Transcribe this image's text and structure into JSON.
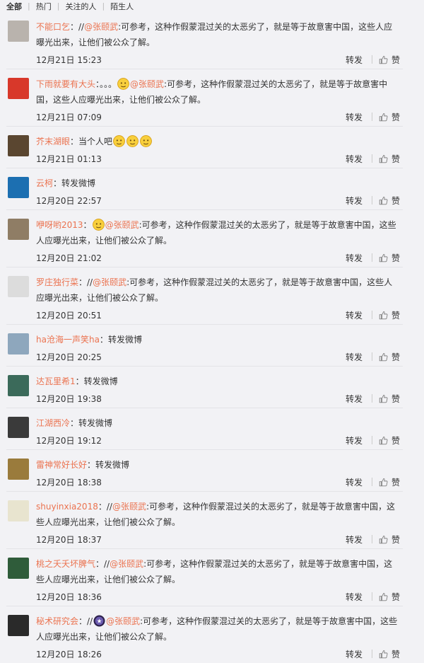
{
  "tabs": [
    "全部",
    "热门",
    "关注的人",
    "陌生人"
  ],
  "actions": {
    "forward": "转发",
    "like": "赞"
  },
  "comments": [
    {
      "user": "不能口乞",
      "sep": "：//",
      "mention": "@张颐武",
      "text": ":可参考，这种作假蒙混过关的太恶劣了，就是等于故意害中国，这些人应曝光出来，让他们被公众了解。",
      "time": "12月21日 15:23",
      "avatar_color": "#b9b3ad",
      "emoji": ""
    },
    {
      "user": "下雨就要有大头",
      "sep": "：。。。",
      "mention": "@张颐武",
      "text": ":可参考，这种作假蒙混过关的太恶劣了，就是等于故意害中国，这些人应曝光出来，让他们被公众了解。",
      "time": "12月21日 07:09",
      "avatar_color": "#d8382a",
      "emoji": "think-emoji"
    },
    {
      "user": "芥末湖眼",
      "sep": "：",
      "mention": "",
      "text": "当个人吧",
      "time": "12月21日 01:13",
      "avatar_color": "#5a4630",
      "emoji": "sweat-emoji-x3"
    },
    {
      "user": "云柯",
      "sep": "：",
      "mention": "",
      "text": "转发微博",
      "time": "12月20日 22:57",
      "avatar_color": "#1c6fb1",
      "emoji": ""
    },
    {
      "user": "咿呀哟2013",
      "sep": "：",
      "mention": "@张颐武",
      "text": ":可参考，这种作假蒙混过关的太恶劣了，就是等于故意害中国，这些人应曝光出来，让他们被公众了解。",
      "time": "12月20日 21:02",
      "avatar_color": "#8f7d65",
      "emoji": "yummy-emoji"
    },
    {
      "user": "罗庄独行菜",
      "sep": "：//",
      "mention": "@张颐武",
      "text": ":可参考，这种作假蒙混过关的太恶劣了，就是等于故意害中国，这些人应曝光出来，让他们被公众了解。",
      "time": "12月20日 20:51",
      "avatar_color": "#dcdcdc",
      "emoji": ""
    },
    {
      "user": "ha沧海一声笑ha",
      "sep": "：",
      "mention": "",
      "text": "转发微博",
      "time": "12月20日 20:25",
      "avatar_color": "#8ea7bd",
      "emoji": ""
    },
    {
      "user": "达瓦里希1",
      "sep": "：",
      "mention": "",
      "text": "转发微博",
      "time": "12月20日 19:38",
      "avatar_color": "#3b6a5a",
      "emoji": ""
    },
    {
      "user": "江湖西冷",
      "sep": "：",
      "mention": "",
      "text": "转发微博",
      "time": "12月20日 19:12",
      "avatar_color": "#3a3a3a",
      "emoji": ""
    },
    {
      "user": "雷神常好长好",
      "sep": "：",
      "mention": "",
      "text": "转发微博",
      "time": "12月20日 18:38",
      "avatar_color": "#9a7b3c",
      "emoji": ""
    },
    {
      "user": "shuyinxia2018",
      "sep": "：//",
      "mention": "@张颐武",
      "text": ":可参考，这种作假蒙混过关的太恶劣了，就是等于故意害中国，这些人应曝光出来，让他们被公众了解。",
      "time": "12月20日 18:37",
      "avatar_color": "#e8e4cf",
      "emoji": ""
    },
    {
      "user": "桃之夭夭坏脾气",
      "sep": "：//",
      "mention": "@张颐武",
      "text": ":可参考，这种作假蒙混过关的太恶劣了，就是等于故意害中国，这些人应曝光出来，让他们被公众了解。",
      "time": "12月20日 18:36",
      "avatar_color": "#2f5c3a",
      "emoji": ""
    },
    {
      "user": "秘术研究会",
      "sep": "：//",
      "mention": "@张颐武",
      "text": ":可参考，这种作假蒙混过关的太恶劣了，就是等于故意害中国，这些人应曝光出来，让他们被公众了解。",
      "time": "12月20日 18:26",
      "avatar_color": "#2a2a2a",
      "emoji": "badge-icon"
    }
  ]
}
